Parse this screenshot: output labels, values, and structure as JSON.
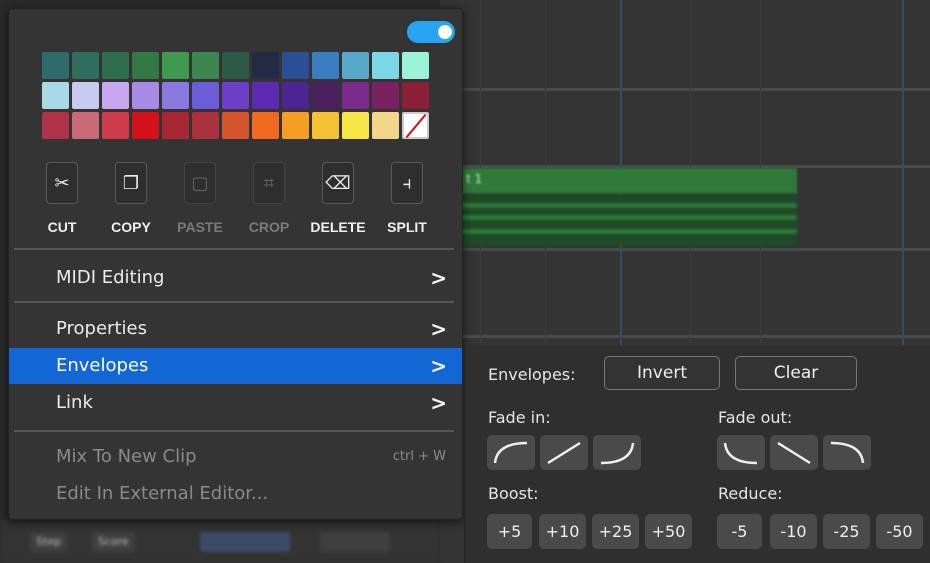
{
  "palette": {
    "rows": [
      [
        "#2e6b6b",
        "#2f6e5e",
        "#2e6e4d",
        "#327a45",
        "#3f9a4e",
        "#3d8650",
        "#2d5a47",
        "#232a44",
        "#2a4f95",
        "#3a7ec2",
        "#56a9c9",
        "#7ad7e6",
        "#9af3d6"
      ],
      [
        "#a7d9e6",
        "#c7cbf2",
        "#c8a6f0",
        "#a98ae6",
        "#8a7ade",
        "#6a5dd6",
        "#6d3fc8",
        "#5c2ab0",
        "#4c2590",
        "#4a1f5e",
        "#7a2a8c",
        "#7a2161",
        "#8a1f35"
      ],
      [
        "#b03246",
        "#c86a78",
        "#cf3d4a",
        "#d41019",
        "#a62833",
        "#a9323d",
        "#d5562a",
        "#f06a1f",
        "#f59e25",
        "#f6c235",
        "#f6e646",
        "#f2d78a",
        "none"
      ]
    ]
  },
  "tools": [
    {
      "label": "CUT",
      "icon": "✂",
      "disabled": false
    },
    {
      "label": "COPY",
      "icon": "❐",
      "disabled": false
    },
    {
      "label": "PASTE",
      "icon": "▢",
      "disabled": true
    },
    {
      "label": "CROP",
      "icon": "⌗",
      "disabled": true
    },
    {
      "label": "DELETE",
      "icon": "⌫",
      "disabled": false
    },
    {
      "label": "SPLIT",
      "icon": "⫞",
      "disabled": false
    }
  ],
  "menu": {
    "midi_editing": "MIDI Editing",
    "properties": "Properties",
    "envelopes": "Envelopes",
    "link": "Link",
    "mix_to_new_clip": "Mix To New Clip",
    "mix_shortcut": "ctrl + W",
    "edit_external": "Edit In External Editor...",
    "chevron": ">"
  },
  "envelopes_panel": {
    "title": "Envelopes:",
    "invert": "Invert",
    "clear": "Clear",
    "fade_in": "Fade in:",
    "fade_out": "Fade out:",
    "boost": "Boost:",
    "reduce": "Reduce:",
    "boost_values": [
      "+5",
      "+10",
      "+25",
      "+50"
    ],
    "reduce_values": [
      "-5",
      "-10",
      "-25",
      "-50"
    ]
  },
  "clip": {
    "name": "t 1"
  },
  "bottombar": [
    "Step",
    "Score"
  ]
}
